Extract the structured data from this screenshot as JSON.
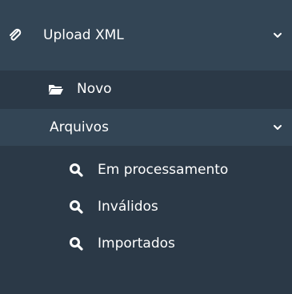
{
  "menu": {
    "upload": {
      "label": "Upload XML",
      "icon": "paperclip-icon",
      "expanded": true
    },
    "novo": {
      "label": "Novo",
      "icon": "folder-open-icon"
    },
    "arquivos": {
      "label": "Arquivos",
      "expanded": true,
      "items": [
        {
          "label": "Em processamento",
          "icon": "search-icon"
        },
        {
          "label": "Inválidos",
          "icon": "search-icon"
        },
        {
          "label": "Importados",
          "icon": "search-icon"
        }
      ]
    }
  },
  "colors": {
    "background": "#2f3f4d",
    "top_header": "#334555",
    "submenu": "#2b3947",
    "active_row": "#334555",
    "text": "#ffffff"
  }
}
